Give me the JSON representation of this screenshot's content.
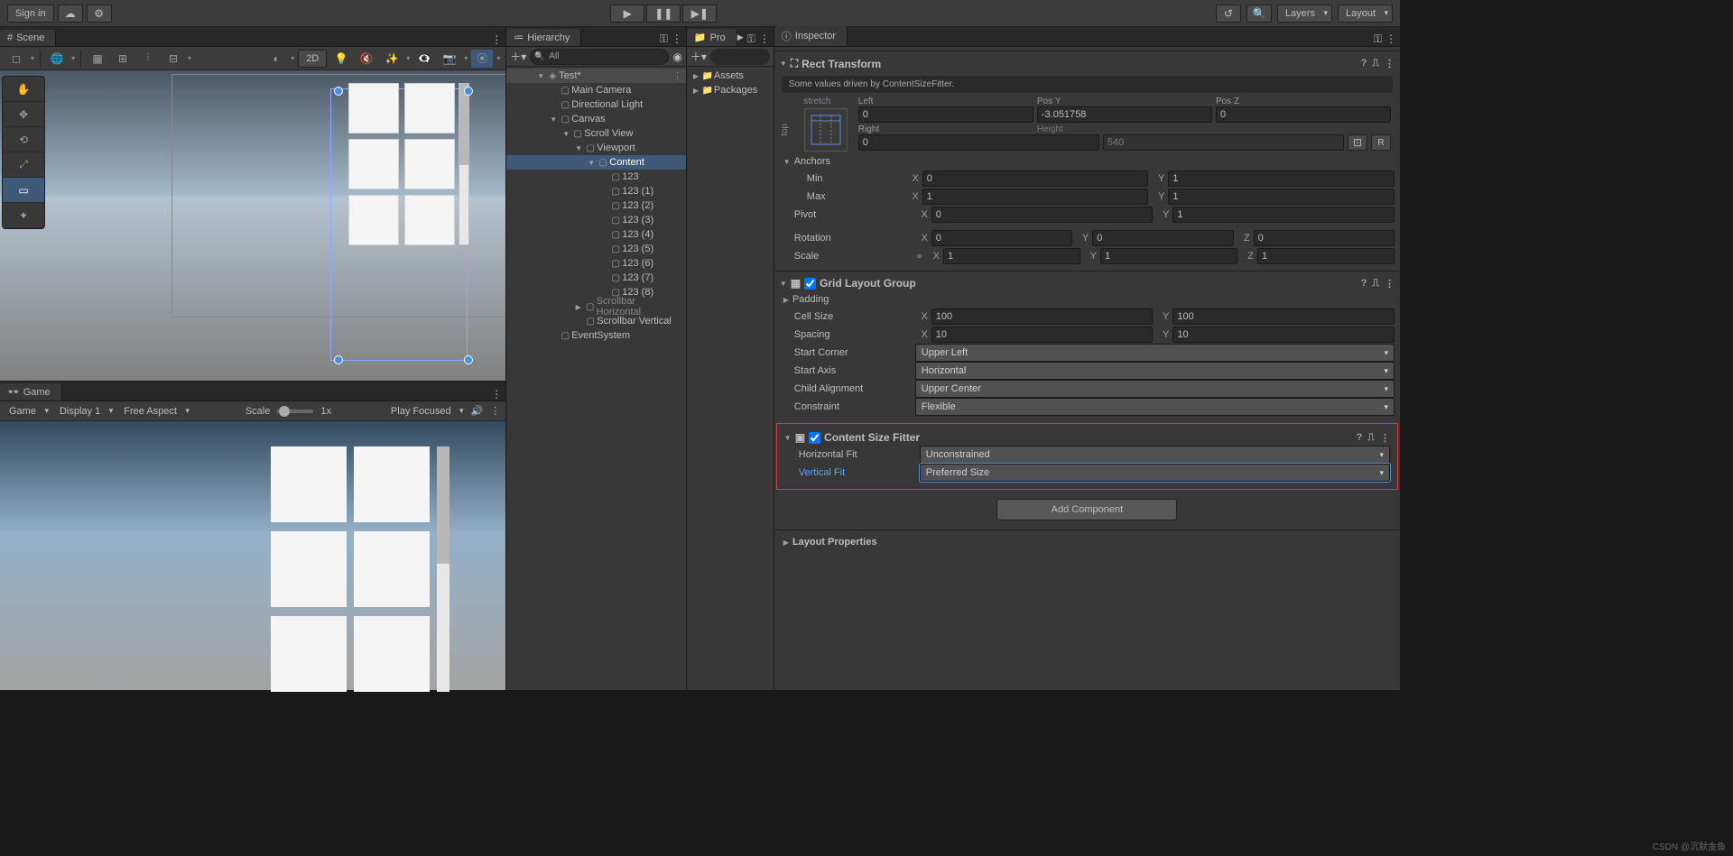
{
  "toolbar": {
    "signin": "Sign in",
    "layers": "Layers",
    "layout": "Layout"
  },
  "scene": {
    "tab": "Scene",
    "mode2d": "2D"
  },
  "game": {
    "tab": "Game",
    "target": "Game",
    "display": "Display 1",
    "aspect": "Free Aspect",
    "scale_label": "Scale",
    "scale_value": "1x",
    "play_mode": "Play Focused"
  },
  "hierarchy": {
    "tab": "Hierarchy",
    "search_placeholder": "All",
    "scene": "Test*",
    "items": [
      "Main Camera",
      "Directional Light",
      "Canvas",
      "Scroll View",
      "Viewport",
      "Content",
      "123",
      "123 (1)",
      "123 (2)",
      "123 (3)",
      "123 (4)",
      "123 (5)",
      "123 (6)",
      "123 (7)",
      "123 (8)",
      "Scrollbar Horizontal",
      "Scrollbar Vertical",
      "EventSystem"
    ]
  },
  "project": {
    "tab": "Pro",
    "assets": "Assets",
    "packages": "Packages"
  },
  "inspector": {
    "tab": "Inspector",
    "rect": {
      "title": "Rect Transform",
      "info": "Some values driven by ContentSizeFitter.",
      "anchor_preset_h": "stretch",
      "anchor_preset_v": "top",
      "left_label": "Left",
      "posy_label": "Pos Y",
      "posz_label": "Pos Z",
      "left": "0",
      "posy": "-3.051758",
      "posz": "0",
      "right_label": "Right",
      "height_label": "Height",
      "right": "0",
      "height": "540",
      "anchors_label": "Anchors",
      "min_label": "Min",
      "max_label": "Max",
      "min_x": "0",
      "min_y": "1",
      "max_x": "1",
      "max_y": "1",
      "pivot_label": "Pivot",
      "pivot_x": "0",
      "pivot_y": "1",
      "rotation_label": "Rotation",
      "rot_x": "0",
      "rot_y": "0",
      "rot_z": "0",
      "scale_label": "Scale",
      "scl_x": "1",
      "scl_y": "1",
      "scl_z": "1"
    },
    "grid": {
      "title": "Grid Layout Group",
      "padding_label": "Padding",
      "cell_label": "Cell Size",
      "cell_x": "100",
      "cell_y": "100",
      "spacing_label": "Spacing",
      "sp_x": "10",
      "sp_y": "10",
      "start_corner_label": "Start Corner",
      "start_corner": "Upper Left",
      "start_axis_label": "Start Axis",
      "start_axis": "Horizontal",
      "child_align_label": "Child Alignment",
      "child_align": "Upper Center",
      "constraint_label": "Constraint",
      "constraint": "Flexible"
    },
    "csf": {
      "title": "Content Size Fitter",
      "hfit_label": "Horizontal Fit",
      "hfit": "Unconstrained",
      "vfit_label": "Vertical Fit",
      "vfit": "Preferred Size"
    },
    "add_component": "Add Component",
    "layout_props": "Layout Properties"
  },
  "watermark": "CSDN @沉默金鱼"
}
